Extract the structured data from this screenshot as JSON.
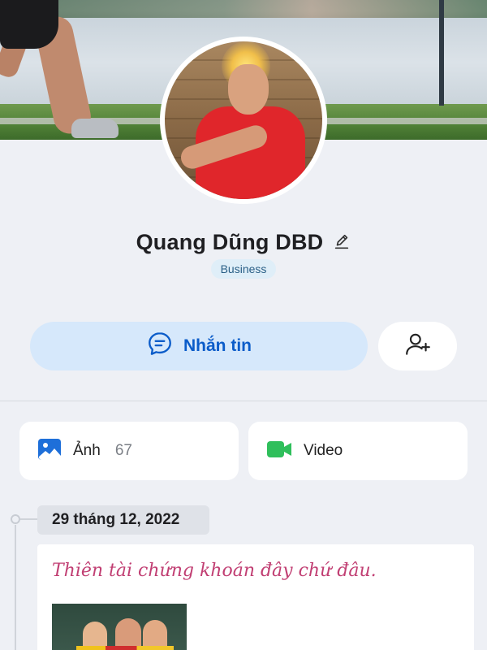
{
  "profile": {
    "name": "Quang Dũng DBD",
    "badge": "Business"
  },
  "actions": {
    "message_label": "Nhắn tin"
  },
  "media": {
    "photos_label": "Ảnh",
    "photos_count": "67",
    "videos_label": "Video"
  },
  "timeline": {
    "date": "29 tháng 12, 2022",
    "post_text": "Thiên tài chứng khoán đây chứ đâu."
  },
  "colors": {
    "primary": "#0b5cc9",
    "message_bg": "#d6e8fb",
    "badge_bg": "#dfeef8",
    "post_text": "#c13f73",
    "video_icon": "#2fbf5b",
    "photo_icon": "#1e6fd9"
  }
}
